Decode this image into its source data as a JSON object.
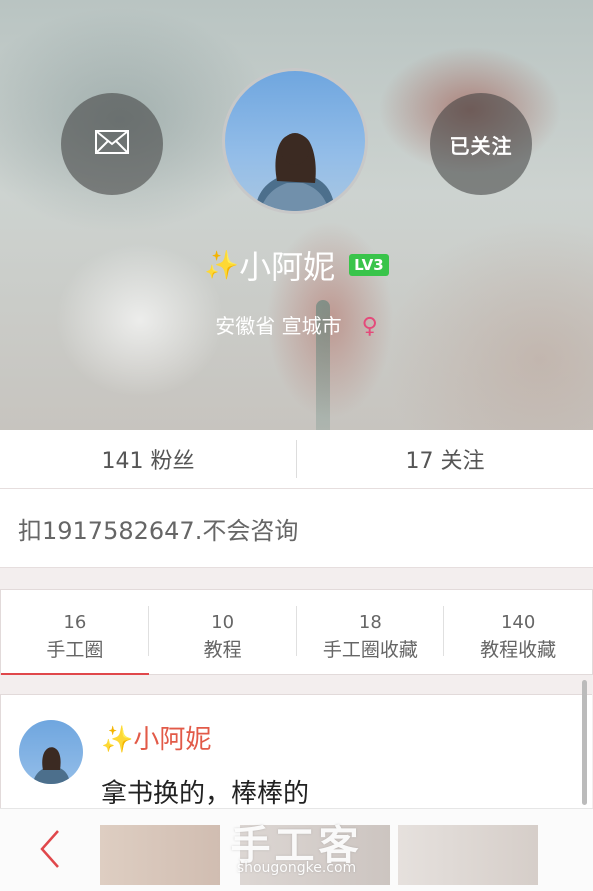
{
  "profile": {
    "sparkle": "✨",
    "name": "小阿妮",
    "level": "LV3",
    "location": "安徽省 宣城市",
    "gender_symbol": "♀",
    "follow_label": "已关注",
    "bio": "扣1917582647.不会咨询"
  },
  "stats": {
    "fans": "141 粉丝",
    "following": "17 关注"
  },
  "tabs": [
    {
      "count": "16",
      "label": "手工圈"
    },
    {
      "count": "10",
      "label": "教程"
    },
    {
      "count": "18",
      "label": "手工圈收藏"
    },
    {
      "count": "140",
      "label": "教程收藏"
    }
  ],
  "active_tab": "手工圈",
  "post": {
    "sparkle": "✨",
    "author": "小阿妮",
    "text": "拿书换的，棒棒的"
  },
  "watermark": {
    "cn": "手工客",
    "en": "shougongke.com"
  },
  "icons": {
    "mail": "mail-icon",
    "back": "back-chevron-icon"
  },
  "colors": {
    "accent": "#e0474b",
    "level_badge": "#39c44a",
    "author_name": "#e25a48",
    "gender": "#e44a7a"
  }
}
